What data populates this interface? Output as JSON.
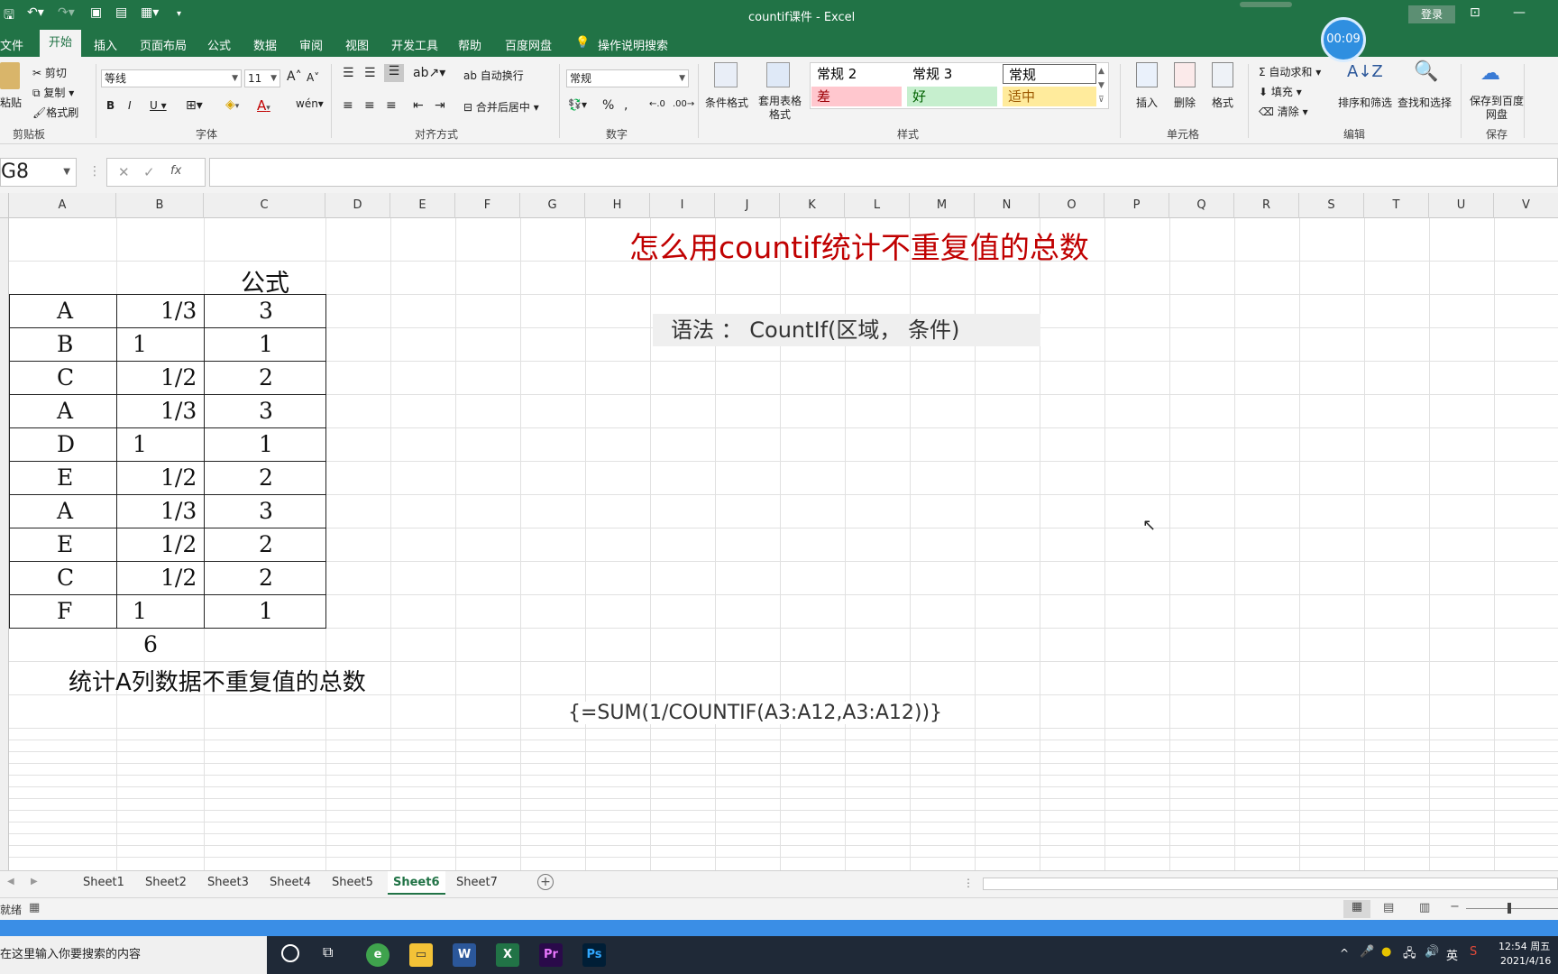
{
  "titlebar": {
    "title": "countif课件  -  Excel",
    "login": "登录",
    "timer": "00:09"
  },
  "tabs": [
    "文件",
    "开始",
    "插入",
    "页面布局",
    "公式",
    "数据",
    "审阅",
    "视图",
    "开发工具",
    "帮助",
    "百度网盘"
  ],
  "tell_me": "操作说明搜索",
  "ribbon": {
    "clipboard": {
      "paste": "粘贴",
      "cut": "剪切",
      "copy": "复制",
      "format_painter": "格式刷",
      "label": "剪贴板"
    },
    "font": {
      "name": "等线",
      "size": "11",
      "label": "字体"
    },
    "align": {
      "wrap": "自动换行",
      "merge": "合并后居中",
      "label": "对齐方式"
    },
    "number": {
      "format": "常规",
      "label": "数字"
    },
    "styles": {
      "cond": "条件格式",
      "table": "套用表格格式",
      "s1": "常规 2",
      "s2": "常规 3",
      "s3": "常规",
      "bad": "差",
      "good": "好",
      "neutral": "适中",
      "label": "样式"
    },
    "cells": {
      "insert": "插入",
      "delete": "删除",
      "format": "格式",
      "label": "单元格"
    },
    "edit": {
      "autosum": "自动求和",
      "fill": "填充",
      "clear": "清除",
      "sort": "排序和筛选",
      "find": "查找和选择",
      "label": "编辑"
    },
    "save": {
      "btn": "保存到百度网盘",
      "label": "保存"
    }
  },
  "formula": {
    "namebox": "G8",
    "value": ""
  },
  "columns": [
    "A",
    "B",
    "C",
    "D",
    "E",
    "F",
    "G",
    "H",
    "I",
    "J",
    "K",
    "L",
    "M",
    "N",
    "O",
    "P",
    "Q",
    "R",
    "S",
    "T",
    "U",
    "V"
  ],
  "content": {
    "title": "怎么用countif统计不重复值的总数",
    "syntax": "语法 ： CountIf(区域， 条件)",
    "header_c": "公式",
    "rows": [
      {
        "a": "A",
        "b": "1/3",
        "c": "3"
      },
      {
        "a": "B",
        "b": "1",
        "c": "1"
      },
      {
        "a": "C",
        "b": "1/2",
        "c": "2"
      },
      {
        "a": "A",
        "b": "1/3",
        "c": "3"
      },
      {
        "a": "D",
        "b": "1",
        "c": "1"
      },
      {
        "a": "E",
        "b": "1/2",
        "c": "2"
      },
      {
        "a": "A",
        "b": "1/3",
        "c": "3"
      },
      {
        "a": "E",
        "b": "1/2",
        "c": "2"
      },
      {
        "a": "C",
        "b": "1/2",
        "c": "2"
      },
      {
        "a": "F",
        "b": "1",
        "c": "1"
      }
    ],
    "total": "6",
    "caption": "统计A列数据不重复值的总数",
    "formula_text": "{=SUM(1/COUNTIF(A3:A12,A3:A12))}"
  },
  "sheets": [
    "Sheet1",
    "Sheet2",
    "Sheet3",
    "Sheet4",
    "Sheet5",
    "Sheet6",
    "Sheet7"
  ],
  "active_sheet": "Sheet6",
  "status": {
    "ready": "就绪"
  },
  "taskbar": {
    "search": "在这里输入你要搜索的内容",
    "time": "12:54 周五",
    "date": "2021/4/16",
    "lang": "英"
  }
}
